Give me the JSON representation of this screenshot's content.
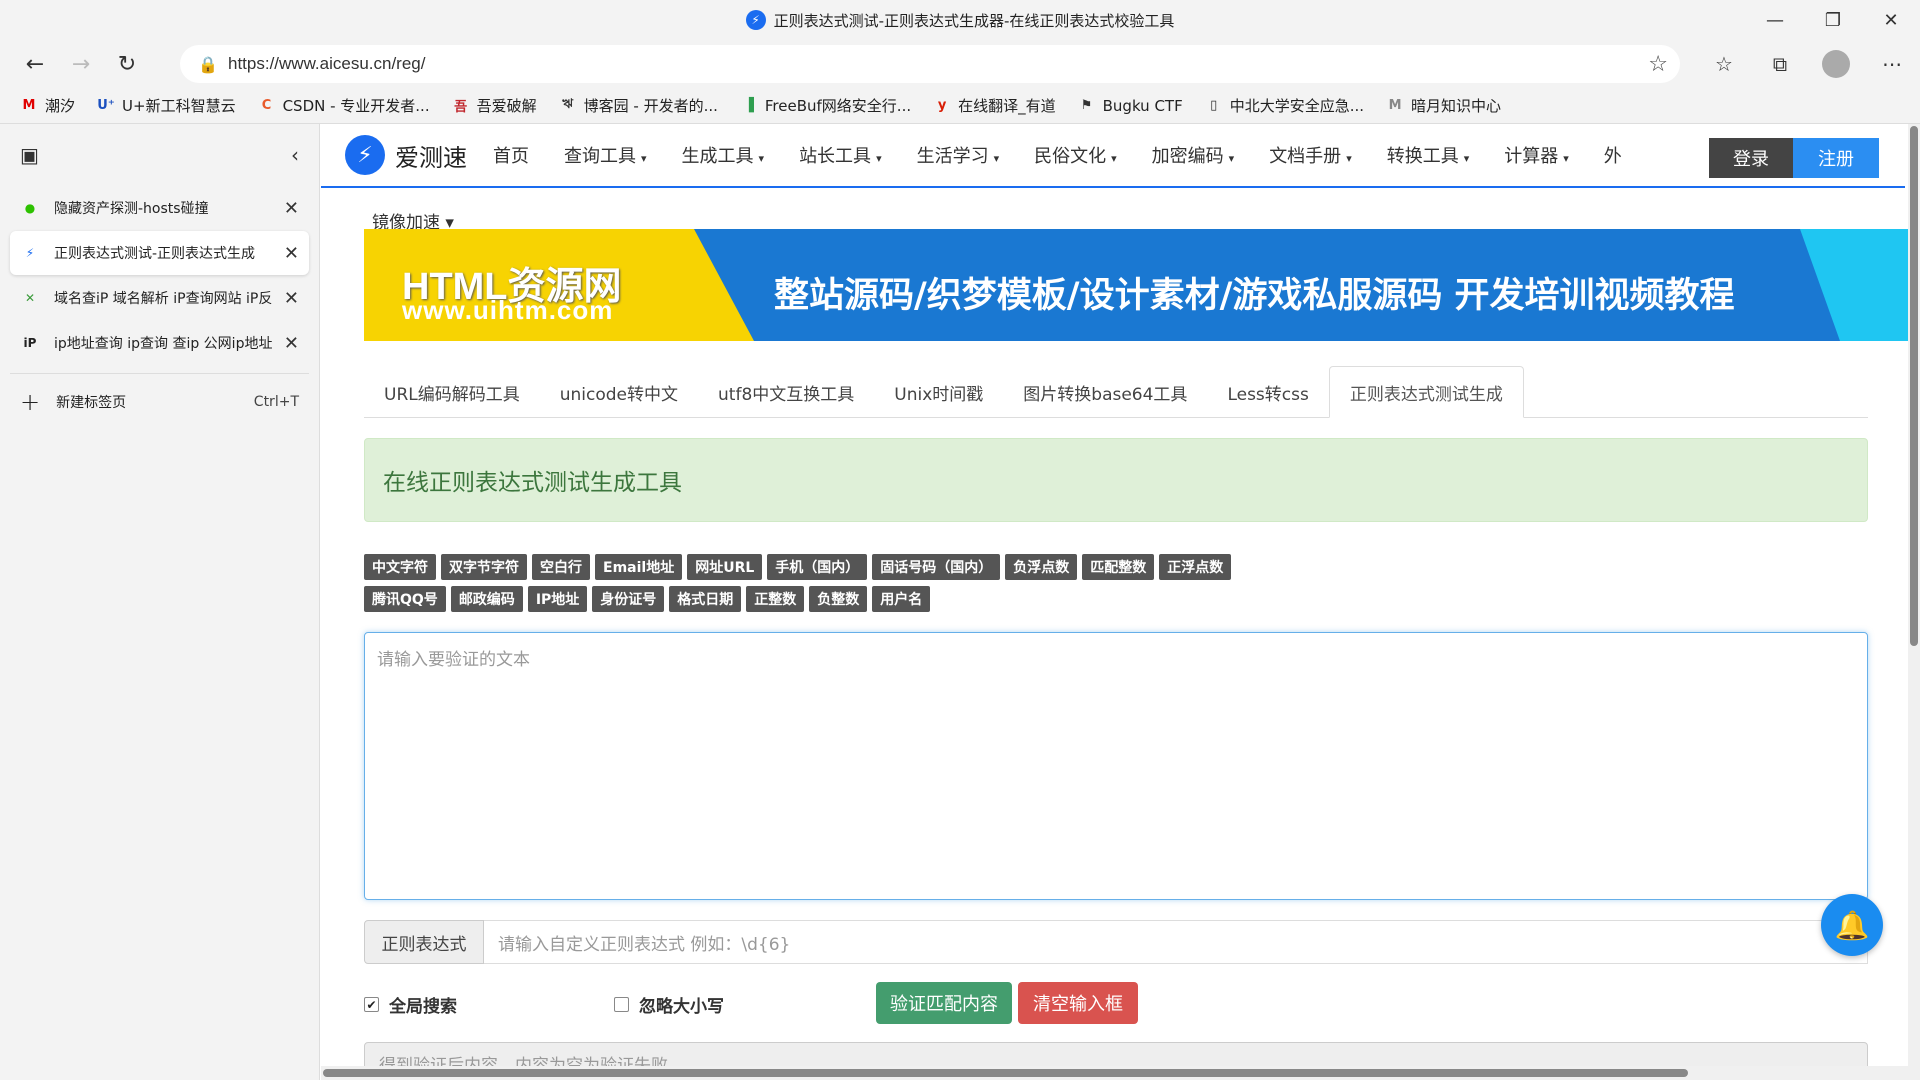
{
  "window": {
    "title": "正则表达式测试-正则表达式生成器-在线正则表达式校验工具",
    "favicon": "⚡",
    "controls": {
      "minimize": "—",
      "maximize": "❐",
      "close": "✕"
    }
  },
  "addressbar": {
    "back": "←",
    "forward": "→",
    "refresh": "↻",
    "lock": "🔒",
    "url": "https://www.aicesu.cn/reg/",
    "add_favorite": "☆",
    "favorites": "☆",
    "collections": "⧉",
    "more": "⋯"
  },
  "bookmarks": [
    {
      "icon": "M",
      "icon_color": "#e00000",
      "label": "潮汐"
    },
    {
      "icon": "U⁺",
      "icon_color": "#1a4fbf",
      "label": "U+新工科智慧云"
    },
    {
      "icon": "C",
      "icon_color": "#e85a2b",
      "label": "CSDN - 专业开发者..."
    },
    {
      "icon": "吾",
      "icon_color": "#c0272d",
      "label": "吾爱破解"
    },
    {
      "icon": "ঋ",
      "icon_color": "#333333",
      "label": "博客园 - 开发者的..."
    },
    {
      "icon": "▐",
      "icon_color": "#2e9e4f",
      "label": "FreeBuf网络安全行..."
    },
    {
      "icon": "y",
      "icon_color": "#d81e06",
      "label": "在线翻译_有道"
    },
    {
      "icon": "⚑",
      "icon_color": "#333333",
      "label": "Bugku CTF"
    },
    {
      "icon": "▯",
      "icon_color": "#333333",
      "label": "中北大学安全应急..."
    },
    {
      "icon": "M",
      "icon_color": "#888888",
      "label": "暗月知识中心"
    }
  ],
  "sidebar": {
    "tab_actions_icon": "▣",
    "collapse_icon": "‹",
    "tabs": [
      {
        "icon": "●",
        "icon_color": "#2dc100",
        "label": "隐藏资产探测-hosts碰撞",
        "close": "✕",
        "active": false
      },
      {
        "icon": "⚡",
        "icon_color": "#1a6cf0",
        "label": "正则表达式测试-正则表达式生成",
        "close": "✕",
        "active": true
      },
      {
        "icon": "✕",
        "icon_color": "#3a9a3a",
        "label": "域名查iP 域名解析 iP查询网站 iP反",
        "close": "✕",
        "active": false
      },
      {
        "icon": "iP",
        "icon_color": "#222222",
        "label": "ip地址查询 ip查询 查ip 公网ip地址",
        "close": "✕",
        "active": false
      }
    ],
    "new_tab": {
      "icon": "+",
      "label": "新建标签页",
      "shortcut": "Ctrl+T"
    }
  },
  "site": {
    "logo_icon": "⚡",
    "logo_text": "爱测速",
    "nav": [
      {
        "label": "首页",
        "has_caret": false
      },
      {
        "label": "查询工具",
        "has_caret": true
      },
      {
        "label": "生成工具",
        "has_caret": true
      },
      {
        "label": "站长工具",
        "has_caret": true
      },
      {
        "label": "生活学习",
        "has_caret": true
      },
      {
        "label": "民俗文化",
        "has_caret": true
      },
      {
        "label": "加密编码",
        "has_caret": true
      },
      {
        "label": "文档手册",
        "has_caret": true
      },
      {
        "label": "转换工具",
        "has_caret": true
      },
      {
        "label": "计算器",
        "has_caret": true
      },
      {
        "label": "外",
        "has_caret": false
      }
    ],
    "caret": "▾",
    "login": "登录",
    "register": "注册",
    "mirror": "镜像加速 ▾",
    "banner": {
      "brand": "HTML资源网",
      "domain": "www.uihtm.com",
      "slogan": "整站源码/织梦模板/设计素材/游戏私服源码   开发培训视频教程"
    },
    "tool_tabs": [
      {
        "label": "URL编码解码工具",
        "active": false
      },
      {
        "label": "unicode转中文",
        "active": false
      },
      {
        "label": "utf8中文互换工具",
        "active": false
      },
      {
        "label": "Unix时间戳",
        "active": false
      },
      {
        "label": "图片转换base64工具",
        "active": false
      },
      {
        "label": "Less转css",
        "active": false
      },
      {
        "label": "正则表达式测试生成",
        "active": true
      }
    ],
    "alert_title": "在线正则表达式测试生成工具",
    "presets_row1": [
      "中文字符",
      "双字节字符",
      "空白行",
      "Email地址",
      "网址URL",
      "手机（国内）",
      "固话号码（国内）",
      "负浮点数",
      "匹配整数",
      "正浮点数"
    ],
    "presets_row2": [
      "腾讯QQ号",
      "邮政编码",
      "IP地址",
      "身份证号",
      "格式日期",
      "正整数",
      "负整数",
      "用户名"
    ],
    "text_placeholder": "请输入要验证的文本",
    "regex_label": "正则表达式",
    "regex_placeholder": "请输入自定义正则表达式 例如：\\d{6}",
    "global_search": {
      "label": "全局搜索",
      "checked": true,
      "mark": "✔"
    },
    "ignore_case": {
      "label": "忽略大小写",
      "checked": false,
      "mark": ""
    },
    "verify_button": "验证匹配内容",
    "clear_button": "清空输入框",
    "result_placeholder": "得到验证后内容，内容为空为验证失败",
    "bell_icon": "🔔"
  },
  "colors": {
    "accent": "#1a6cf0",
    "alert_bg": "#dff0d8",
    "alert_text": "#3c763d",
    "green_btn": "#449d6e",
    "red_btn": "#d9534f"
  }
}
